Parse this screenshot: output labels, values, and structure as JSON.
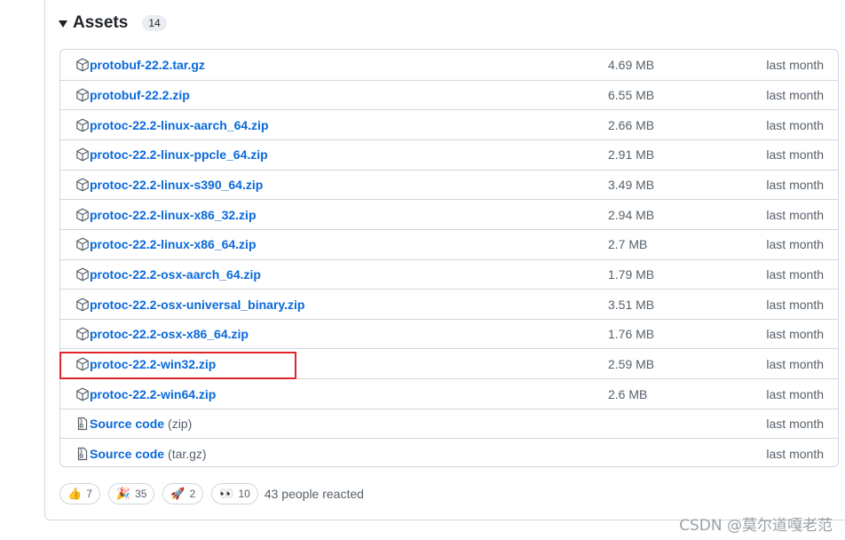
{
  "assets": {
    "title": "Assets",
    "count": "14",
    "items": [
      {
        "name": "protobuf-22.2.tar.gz",
        "ext": "",
        "size": "4.69 MB",
        "date": "last month",
        "icon": "package-icon"
      },
      {
        "name": "protobuf-22.2.zip",
        "ext": "",
        "size": "6.55 MB",
        "date": "last month",
        "icon": "package-icon"
      },
      {
        "name": "protoc-22.2-linux-aarch_64.zip",
        "ext": "",
        "size": "2.66 MB",
        "date": "last month",
        "icon": "package-icon"
      },
      {
        "name": "protoc-22.2-linux-ppcle_64.zip",
        "ext": "",
        "size": "2.91 MB",
        "date": "last month",
        "icon": "package-icon"
      },
      {
        "name": "protoc-22.2-linux-s390_64.zip",
        "ext": "",
        "size": "3.49 MB",
        "date": "last month",
        "icon": "package-icon"
      },
      {
        "name": "protoc-22.2-linux-x86_32.zip",
        "ext": "",
        "size": "2.94 MB",
        "date": "last month",
        "icon": "package-icon"
      },
      {
        "name": "protoc-22.2-linux-x86_64.zip",
        "ext": "",
        "size": "2.7 MB",
        "date": "last month",
        "icon": "package-icon"
      },
      {
        "name": "protoc-22.2-osx-aarch_64.zip",
        "ext": "",
        "size": "1.79 MB",
        "date": "last month",
        "icon": "package-icon"
      },
      {
        "name": "protoc-22.2-osx-universal_binary.zip",
        "ext": "",
        "size": "3.51 MB",
        "date": "last month",
        "icon": "package-icon"
      },
      {
        "name": "protoc-22.2-osx-x86_64.zip",
        "ext": "",
        "size": "1.76 MB",
        "date": "last month",
        "icon": "package-icon"
      },
      {
        "name": "protoc-22.2-win32.zip",
        "ext": "",
        "size": "2.59 MB",
        "date": "last month",
        "icon": "package-icon"
      },
      {
        "name": "protoc-22.2-win64.zip",
        "ext": "",
        "size": "2.6 MB",
        "date": "last month",
        "icon": "package-icon"
      },
      {
        "name": "Source code",
        "ext": "(zip)",
        "size": "",
        "date": "last month",
        "icon": "file-zip-icon"
      },
      {
        "name": "Source code",
        "ext": "(tar.gz)",
        "size": "",
        "date": "last month",
        "icon": "file-zip-icon"
      }
    ]
  },
  "reactions": {
    "items": [
      {
        "emoji": "👍",
        "count": "7",
        "icon": "thumbs-up-icon"
      },
      {
        "emoji": "🎉",
        "count": "35",
        "icon": "hooray-icon"
      },
      {
        "emoji": "🚀",
        "count": "2",
        "icon": "rocket-icon"
      },
      {
        "emoji": "👀",
        "count": "10",
        "icon": "eyes-icon"
      }
    ],
    "summary": "43 people reacted"
  },
  "watermark": "CSDN @莫尔道嘎老范",
  "colors": {
    "link": "#0969da",
    "muted": "#57606a",
    "border": "#d0d7de",
    "highlight": "#e0262b"
  }
}
